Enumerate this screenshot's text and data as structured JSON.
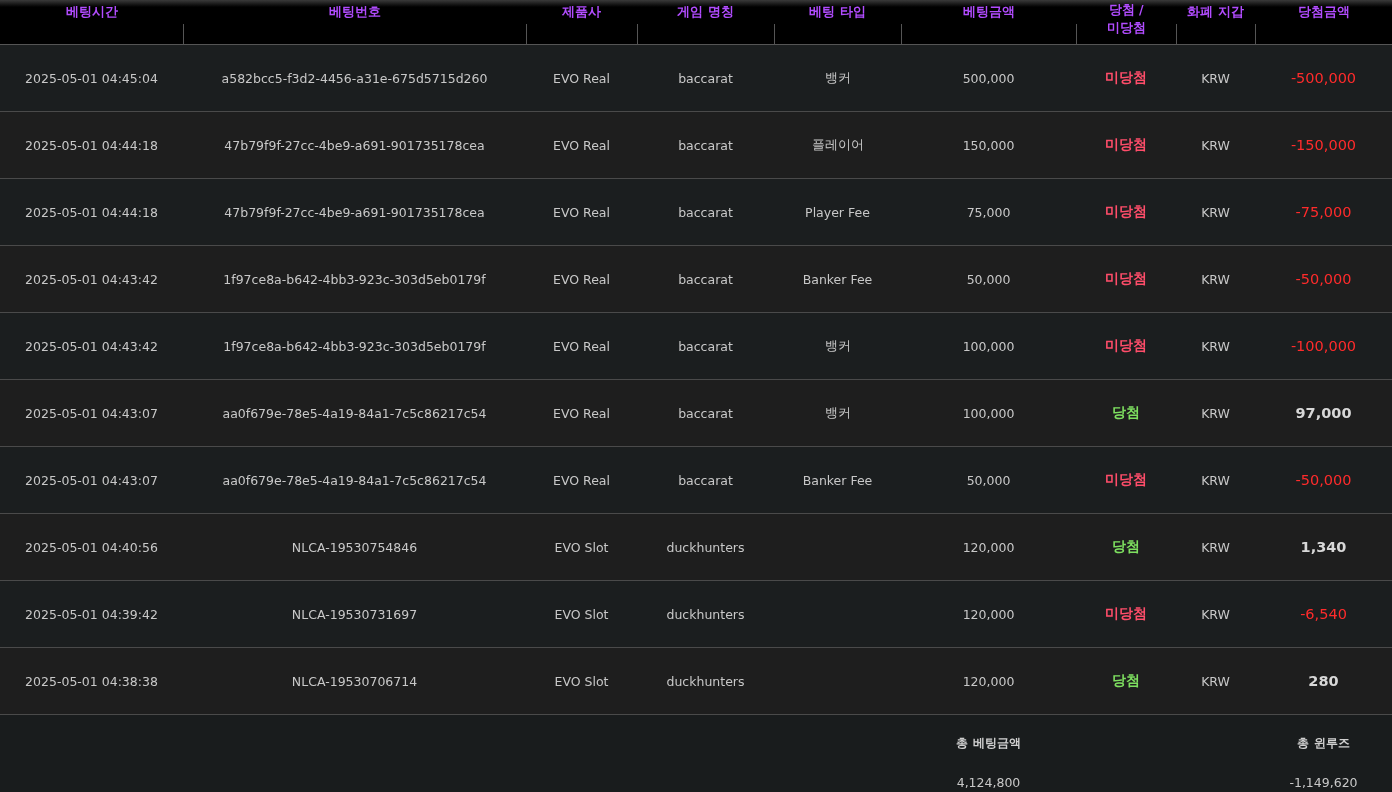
{
  "table": {
    "columns": [
      "베팅시간",
      "베팅번호",
      "제품사",
      "게임 명칭",
      "베팅 타입",
      "베팅금액",
      "당첨 / 미당첨",
      "화폐 지갑",
      "당첨금액"
    ],
    "rows": [
      {
        "time": "2025-05-01 04:45:04",
        "bet_id": "a582bcc5-f3d2-4456-a31e-675d5715d260",
        "provider": "EVO Real",
        "game": "baccarat",
        "bet_type": "뱅커",
        "amount": "500,000",
        "result": "미당첨",
        "won": false,
        "currency": "KRW",
        "payout": "-500,000"
      },
      {
        "time": "2025-05-01 04:44:18",
        "bet_id": "47b79f9f-27cc-4be9-a691-901735178cea",
        "provider": "EVO Real",
        "game": "baccarat",
        "bet_type": "플레이어",
        "amount": "150,000",
        "result": "미당첨",
        "won": false,
        "currency": "KRW",
        "payout": "-150,000"
      },
      {
        "time": "2025-05-01 04:44:18",
        "bet_id": "47b79f9f-27cc-4be9-a691-901735178cea",
        "provider": "EVO Real",
        "game": "baccarat",
        "bet_type": "Player Fee",
        "amount": "75,000",
        "result": "미당첨",
        "won": false,
        "currency": "KRW",
        "payout": "-75,000"
      },
      {
        "time": "2025-05-01 04:43:42",
        "bet_id": "1f97ce8a-b642-4bb3-923c-303d5eb0179f",
        "provider": "EVO Real",
        "game": "baccarat",
        "bet_type": "Banker Fee",
        "amount": "50,000",
        "result": "미당첨",
        "won": false,
        "currency": "KRW",
        "payout": "-50,000"
      },
      {
        "time": "2025-05-01 04:43:42",
        "bet_id": "1f97ce8a-b642-4bb3-923c-303d5eb0179f",
        "provider": "EVO Real",
        "game": "baccarat",
        "bet_type": "뱅커",
        "amount": "100,000",
        "result": "미당첨",
        "won": false,
        "currency": "KRW",
        "payout": "-100,000"
      },
      {
        "time": "2025-05-01 04:43:07",
        "bet_id": "aa0f679e-78e5-4a19-84a1-7c5c86217c54",
        "provider": "EVO Real",
        "game": "baccarat",
        "bet_type": "뱅커",
        "amount": "100,000",
        "result": "당첨",
        "won": true,
        "currency": "KRW",
        "payout": "97,000"
      },
      {
        "time": "2025-05-01 04:43:07",
        "bet_id": "aa0f679e-78e5-4a19-84a1-7c5c86217c54",
        "provider": "EVO Real",
        "game": "baccarat",
        "bet_type": "Banker Fee",
        "amount": "50,000",
        "result": "미당첨",
        "won": false,
        "currency": "KRW",
        "payout": "-50,000"
      },
      {
        "time": "2025-05-01 04:40:56",
        "bet_id": "NLCA-19530754846",
        "provider": "EVO Slot",
        "game": "duckhunters",
        "amount": "120,000",
        "result": "당첨",
        "won": true,
        "currency": "KRW",
        "payout": "1,340"
      },
      {
        "time": "2025-05-01 04:39:42",
        "bet_id": "NLCA-19530731697",
        "provider": "EVO Slot",
        "game": "duckhunters",
        "amount": "120,000",
        "result": "미당첨",
        "won": false,
        "currency": "KRW",
        "payout": "-6,540"
      },
      {
        "time": "2025-05-01 04:38:38",
        "bet_id": "NLCA-19530706714",
        "provider": "EVO Slot",
        "game": "duckhunters",
        "amount": "120,000",
        "result": "당첨",
        "won": true,
        "currency": "KRW",
        "payout": "280"
      }
    ]
  },
  "summary": {
    "total_bet_label": "총 베팅금액",
    "total_bet": "4,124,800",
    "win_loss_label": "총 윈루즈",
    "win_loss": "-1,149,620"
  }
}
